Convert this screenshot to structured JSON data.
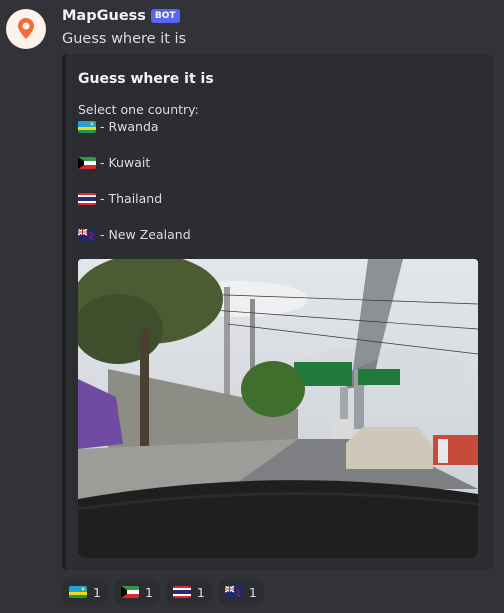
{
  "message": {
    "username": "MapGuess",
    "bot_tag": "BOT",
    "content": "Guess where it is",
    "avatar_icon": "map-pin-icon"
  },
  "embed": {
    "title": "Guess where it is",
    "description": "Select one country:",
    "options": [
      {
        "label": "- Rwanda",
        "flag": "rwanda-flag-icon"
      },
      {
        "label": "- Kuwait",
        "flag": "kuwait-flag-icon"
      },
      {
        "label": "- Thailand",
        "flag": "thailand-flag-icon"
      },
      {
        "label": "- New Zealand",
        "flag": "new-zealand-flag-icon"
      }
    ],
    "image": "street-view-photo"
  },
  "reactions": [
    {
      "flag": "rwanda-flag-icon",
      "count": "1"
    },
    {
      "flag": "kuwait-flag-icon",
      "count": "1"
    },
    {
      "flag": "thailand-flag-icon",
      "count": "1"
    },
    {
      "flag": "new-zealand-flag-icon",
      "count": "1"
    }
  ],
  "colors": {
    "background": "#313338",
    "embed_bg": "#2b2d31",
    "bot_tag": "#5865f2",
    "avatar_accent": "#f26b3a"
  }
}
